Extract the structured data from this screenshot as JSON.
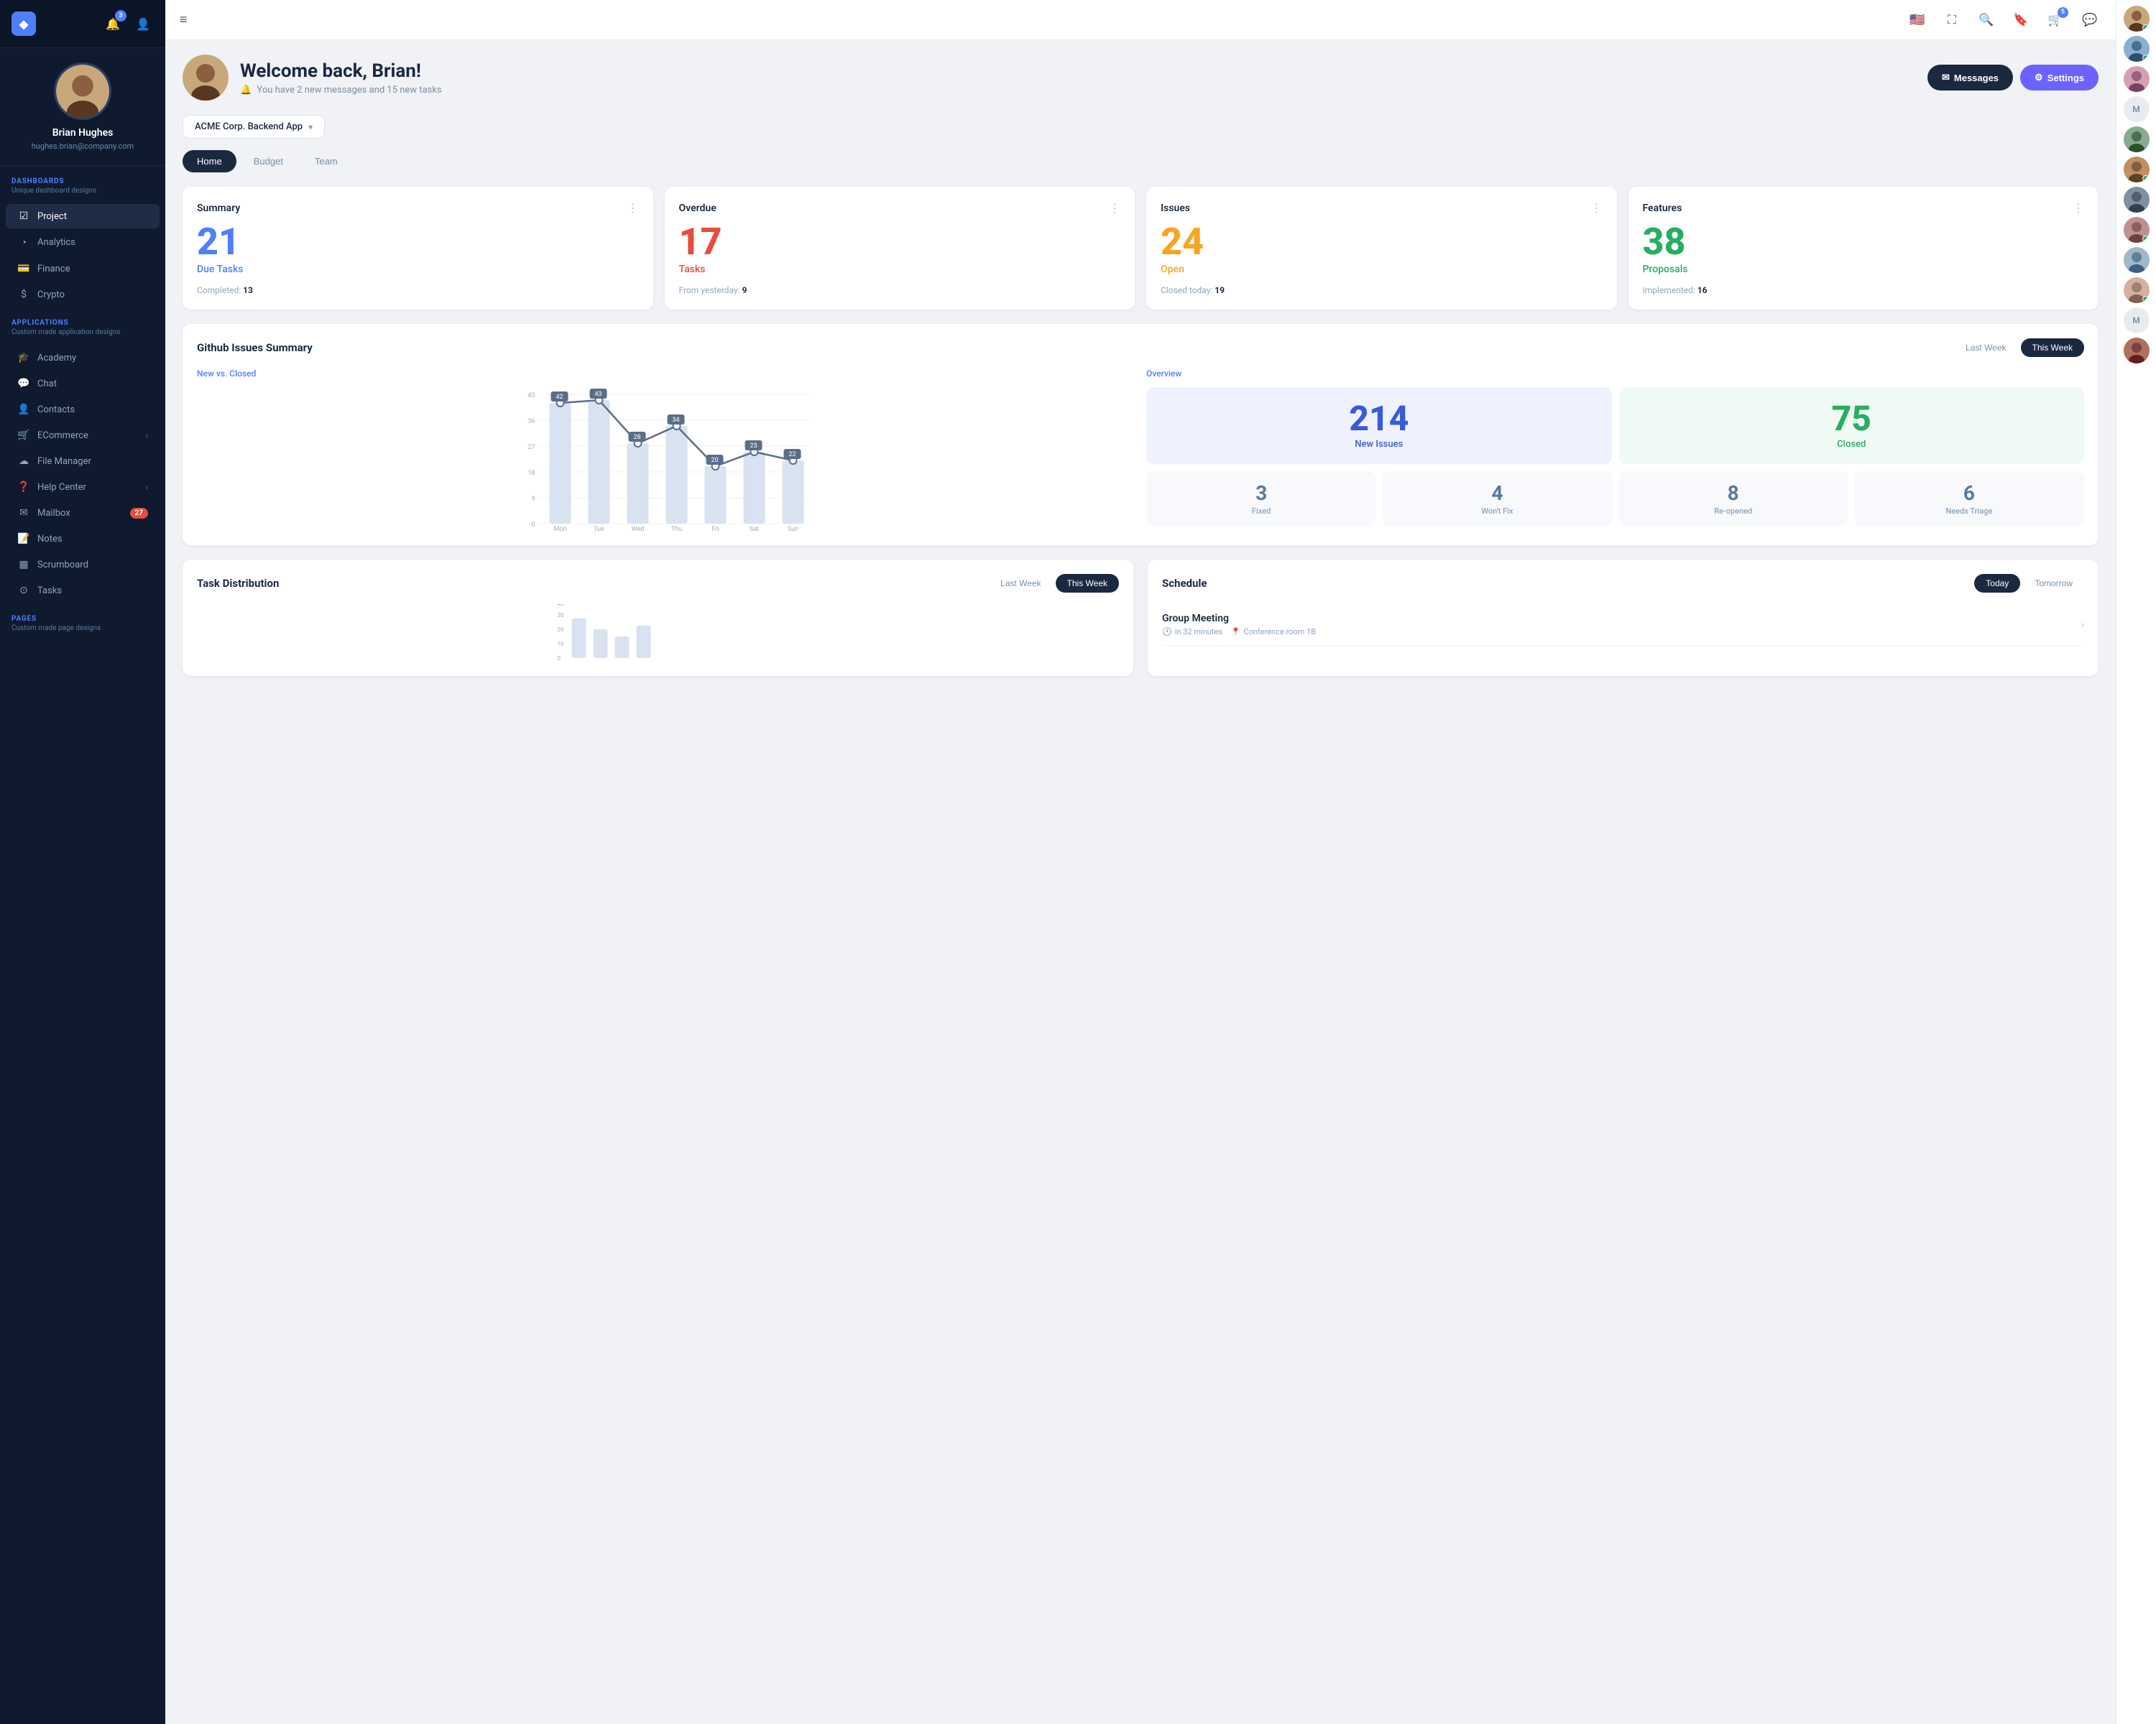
{
  "sidebar": {
    "logo": "◆",
    "notifications_badge": "3",
    "profile": {
      "name": "Brian Hughes",
      "email": "hughes.brian@company.com"
    },
    "dashboards": {
      "label": "DASHBOARDS",
      "sub": "Unique dashboard designs",
      "items": [
        {
          "id": "project",
          "icon": "☑",
          "label": "Project",
          "active": true
        },
        {
          "id": "analytics",
          "icon": "◔",
          "label": "Analytics"
        },
        {
          "id": "finance",
          "icon": "💳",
          "label": "Finance"
        },
        {
          "id": "crypto",
          "icon": "$",
          "label": "Crypto"
        }
      ]
    },
    "applications": {
      "label": "APPLICATIONS",
      "sub": "Custom made application designs",
      "items": [
        {
          "id": "academy",
          "icon": "🎓",
          "label": "Academy"
        },
        {
          "id": "chat",
          "icon": "💬",
          "label": "Chat"
        },
        {
          "id": "contacts",
          "icon": "👤",
          "label": "Contacts"
        },
        {
          "id": "ecommerce",
          "icon": "🛒",
          "label": "ECommerce",
          "arrow": true
        },
        {
          "id": "filemanager",
          "icon": "☁",
          "label": "File Manager"
        },
        {
          "id": "helpcenter",
          "icon": "❓",
          "label": "Help Center",
          "arrow": true
        },
        {
          "id": "mailbox",
          "icon": "✉",
          "label": "Mailbox",
          "badge": "27"
        },
        {
          "id": "notes",
          "icon": "📝",
          "label": "Notes"
        },
        {
          "id": "scrumboard",
          "icon": "▦",
          "label": "Scrumboard"
        },
        {
          "id": "tasks",
          "icon": "⊙",
          "label": "Tasks"
        }
      ]
    },
    "pages": {
      "label": "PAGES",
      "sub": "Custom made page designs"
    }
  },
  "topbar": {
    "menu_icon": "≡",
    "flag": "🇺🇸",
    "fullscreen": "⛶",
    "search": "🔍",
    "bookmark": "🔖",
    "cart_badge": "5",
    "messages": "💬"
  },
  "welcome": {
    "title": "Welcome back, Brian!",
    "subtitle": "You have 2 new messages and 15 new tasks",
    "messages_btn": "Messages",
    "settings_btn": "Settings"
  },
  "project_selector": {
    "label": "ACME Corp. Backend App"
  },
  "tabs": [
    {
      "id": "home",
      "label": "Home",
      "active": true
    },
    {
      "id": "budget",
      "label": "Budget"
    },
    {
      "id": "team",
      "label": "Team"
    }
  ],
  "stats": [
    {
      "id": "summary",
      "title": "Summary",
      "number": "21",
      "label": "Due Tasks",
      "color": "blue",
      "footer_key": "Completed:",
      "footer_val": "13"
    },
    {
      "id": "overdue",
      "title": "Overdue",
      "number": "17",
      "label": "Tasks",
      "color": "red",
      "footer_key": "From yesterday:",
      "footer_val": "9"
    },
    {
      "id": "issues",
      "title": "Issues",
      "number": "24",
      "label": "Open",
      "color": "orange",
      "footer_key": "Closed today:",
      "footer_val": "19"
    },
    {
      "id": "features",
      "title": "Features",
      "number": "38",
      "label": "Proposals",
      "color": "green",
      "footer_key": "Implemented:",
      "footer_val": "16"
    }
  ],
  "github": {
    "title": "Github Issues Summary",
    "last_week": "Last Week",
    "this_week": "This Week",
    "chart_label": "New vs. Closed",
    "chart_days": [
      "Mon",
      "Tue",
      "Wed",
      "Thu",
      "Fri",
      "Sat",
      "Sun"
    ],
    "chart_bars": [
      42,
      43,
      28,
      34,
      20,
      25,
      22
    ],
    "chart_y": [
      45,
      36,
      27,
      18,
      9,
      0
    ],
    "overview_label": "Overview",
    "new_issues": "214",
    "new_issues_label": "New Issues",
    "closed": "75",
    "closed_label": "Closed",
    "mini_stats": [
      {
        "num": "3",
        "label": "Fixed"
      },
      {
        "num": "4",
        "label": "Won't Fix"
      },
      {
        "num": "8",
        "label": "Re-opened"
      },
      {
        "num": "6",
        "label": "Needs Triage"
      }
    ]
  },
  "task_dist": {
    "title": "Task Distribution",
    "last_week": "Last Week",
    "this_week": "This Week"
  },
  "schedule": {
    "title": "Schedule",
    "today": "Today",
    "tomorrow": "Tomorrow",
    "events": [
      {
        "title": "Group Meeting",
        "time": "in 32 minutes",
        "location": "Conference room 1B"
      }
    ]
  },
  "right_avatars": [
    {
      "id": "a1",
      "color": "#c8a87a",
      "online": true
    },
    {
      "id": "a2",
      "color": "#8aafd0",
      "online": true
    },
    {
      "id": "a3",
      "color": "#d4a0b0",
      "online": false
    },
    {
      "id": "a4",
      "label": "M",
      "is_placeholder": true
    },
    {
      "id": "a5",
      "color": "#7a9080",
      "online": false
    },
    {
      "id": "a6",
      "color": "#b08050",
      "online": true
    },
    {
      "id": "a7",
      "color": "#708090",
      "online": false
    },
    {
      "id": "a8",
      "color": "#c09090",
      "online": true
    },
    {
      "id": "a9",
      "color": "#a0b8c8",
      "online": false
    },
    {
      "id": "a10",
      "color": "#d4b0a0",
      "online": true
    },
    {
      "id": "a11",
      "label": "M",
      "is_placeholder": true
    },
    {
      "id": "a12",
      "color": "#b07060",
      "online": false
    }
  ]
}
